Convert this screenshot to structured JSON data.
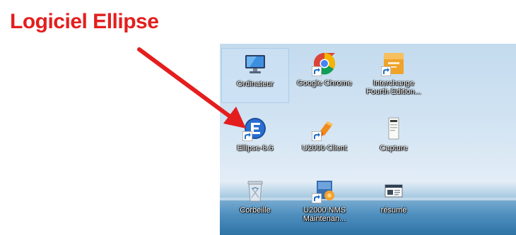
{
  "headline": "Logiciel Ellipse",
  "accent_color": "#e41e1e",
  "desktop": {
    "icons": [
      {
        "label": "Ordinateur",
        "icon": "computer-icon",
        "selected": true
      },
      {
        "label": "Google Chrome",
        "icon": "chrome-icon"
      },
      {
        "label": "Interchange Fourth Edition...",
        "icon": "interchange-icon"
      },
      {
        "label": "Ellipse-8.6",
        "icon": "ellipse-app-icon"
      },
      {
        "label": "U2000 Client",
        "icon": "u2000-client-icon"
      },
      {
        "label": "Capture",
        "icon": "capture-icon"
      },
      {
        "label": "Corbeille",
        "icon": "recycle-bin-icon"
      },
      {
        "label": "U2000 NMS Maintenan...",
        "icon": "u2000-nms-icon"
      },
      {
        "label": "résumé",
        "icon": "document-icon"
      }
    ]
  }
}
